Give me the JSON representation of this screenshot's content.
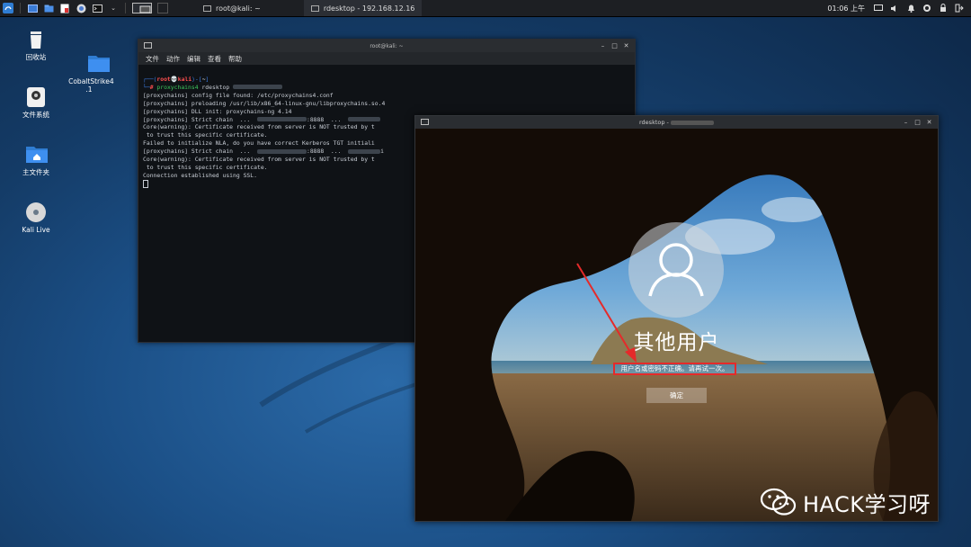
{
  "panel": {
    "tasks": [
      {
        "label": "root@kali: ~",
        "active": false
      },
      {
        "label": "rdesktop - 192.168.12.16",
        "active": true
      }
    ],
    "clock": "01:06 上午"
  },
  "desktop_icons": [
    {
      "label": "回收站",
      "icon": "trash-icon"
    },
    {
      "label": "CobaltStrike4\n.1",
      "icon": "folder-icon"
    },
    {
      "label": "文件系统",
      "icon": "drive-icon"
    },
    {
      "label": "主文件夹",
      "icon": "home-folder-icon"
    },
    {
      "label": "Kali Live",
      "icon": "disc-icon"
    }
  ],
  "terminal": {
    "title": "root@kali: ~",
    "menu": [
      "文件",
      "动作",
      "编辑",
      "查看",
      "帮助"
    ],
    "prompt_user": "root",
    "prompt_host": "kali",
    "prompt_dir": "~",
    "command_prefix": "proxychains4",
    "command_rest": " rdesktop",
    "lines": [
      "[proxychains] config file found: /etc/proxychains4.conf",
      "[proxychains] preloading /usr/lib/x86_64-linux-gnu/libproxychains.so.4",
      "[proxychains] DLL init: proxychains-ng 4.14"
    ],
    "chain1_prefix": "[proxychains] Strict chain  ...  ",
    "chain1_port": ":8888  ...  ",
    "cert1_a": "Core(warning): Certificate received from server is NOT trusted by t",
    "cert1_b": " to trust this specific certificate.",
    "nla": "Failed to initialize NLA, do you have correct Kerberos TGT initiali",
    "chain2_prefix": "[proxychains] Strict chain  ...  ",
    "chain2_port": ":8888  ...  ",
    "chain2_tail": "i",
    "cert2_a": "Core(warning): Certificate received from server is NOT trusted by t",
    "cert2_b": " to trust this specific certificate.",
    "connected": "Connection established using SSL."
  },
  "rdesktop": {
    "title": "rdesktop -",
    "username": "其他用户",
    "error": "用户名或密码不正确。请再试一次。",
    "ok_button": "确定"
  },
  "watermark": {
    "text": "HACK学习呀"
  },
  "colors": {
    "error_border": "#e52a2a",
    "arrow": "#e52a2a",
    "prompt_user": "#ff4f4f",
    "prompt_cmd": "#3ec85d"
  }
}
